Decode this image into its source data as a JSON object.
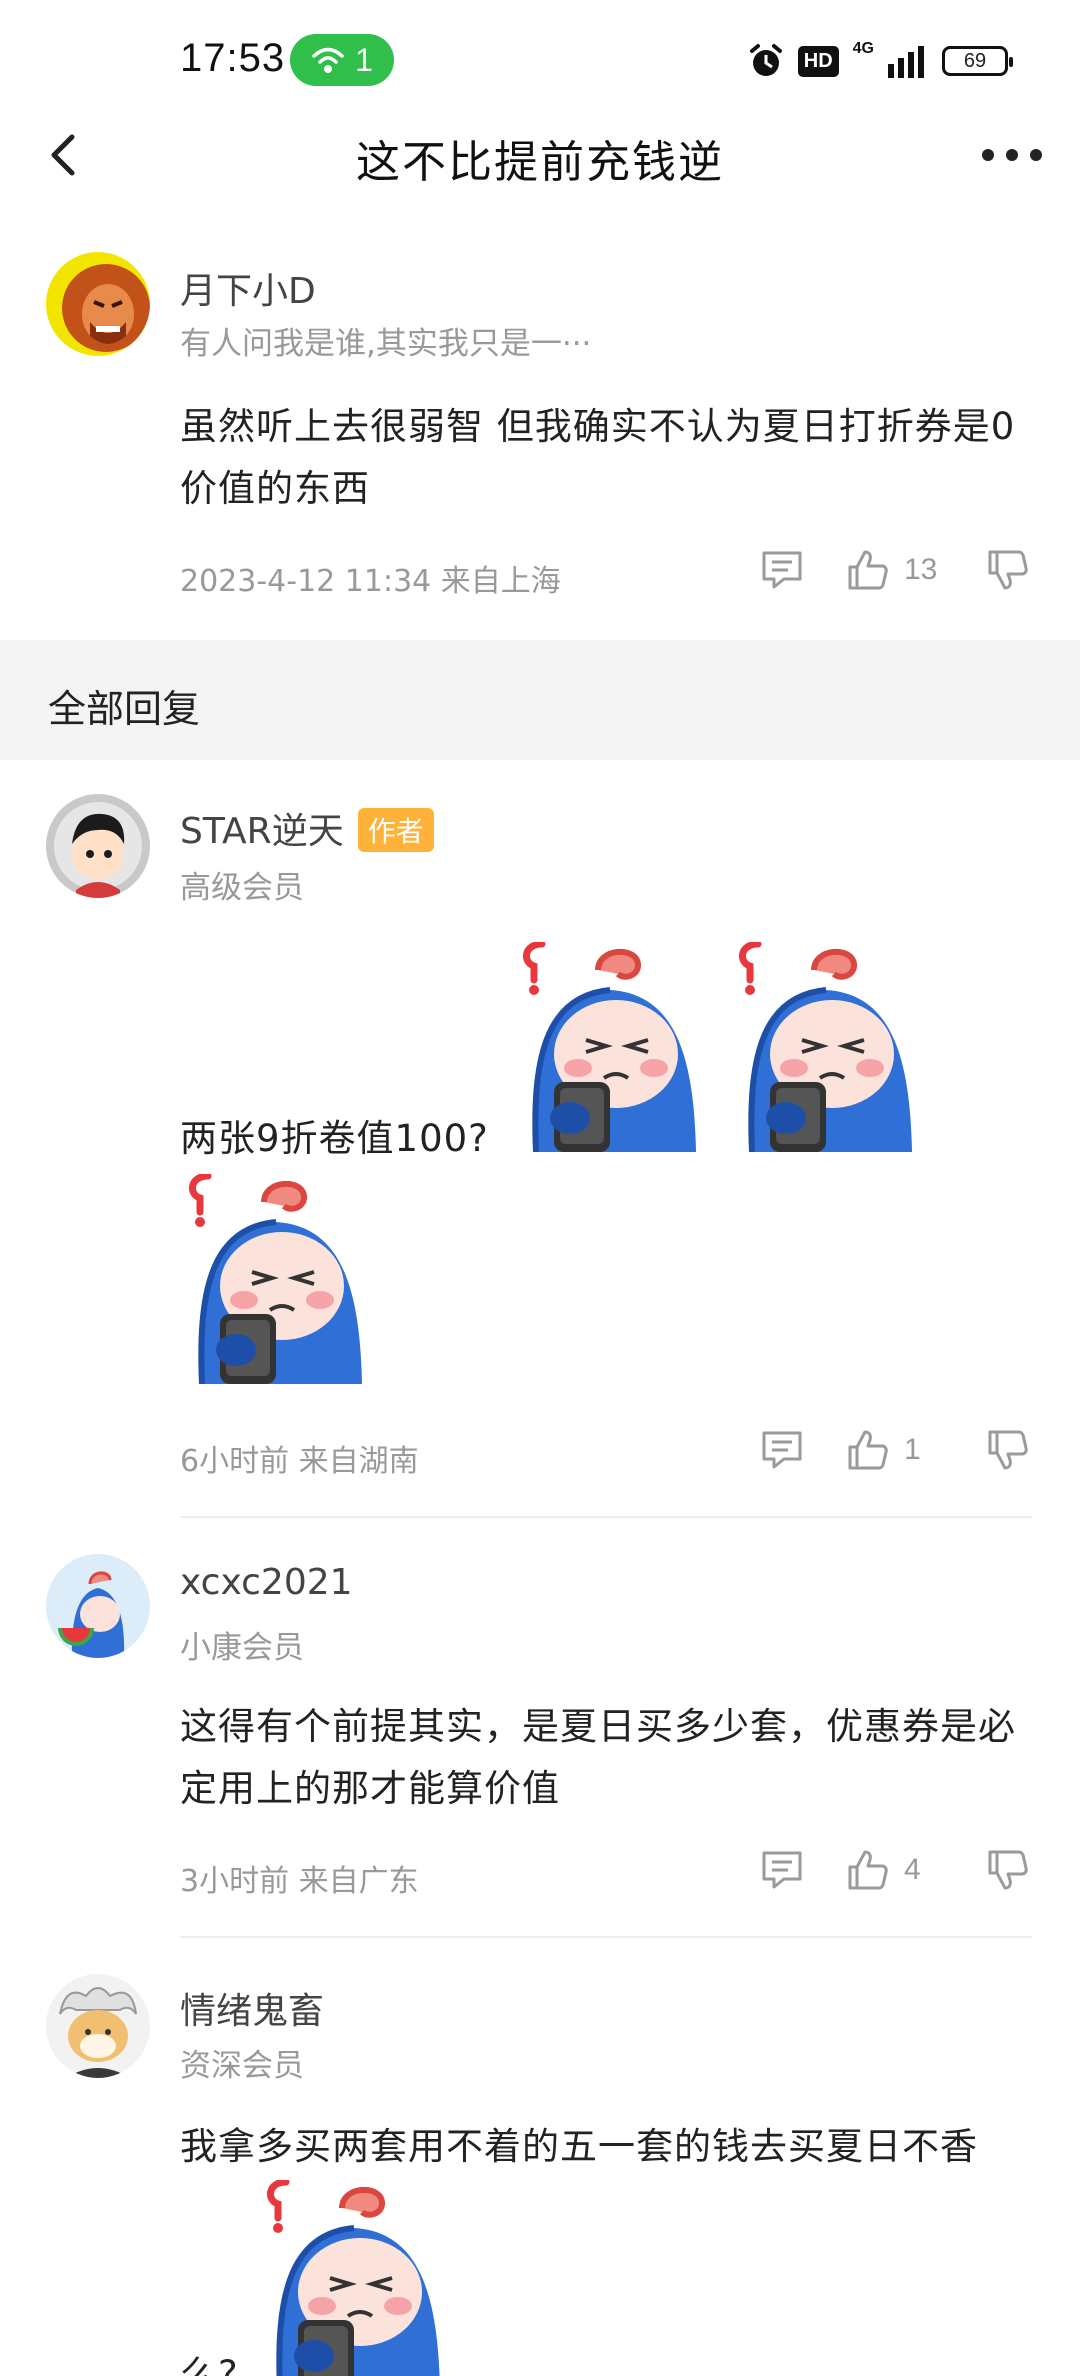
{
  "status": {
    "time": "17:53",
    "hotspot_count": "1",
    "network": "4G",
    "battery": "69"
  },
  "nav": {
    "title": "这不比提前充钱逆"
  },
  "main_post": {
    "username": "月下小D",
    "signature": "有人问我是谁,其实我只是一···",
    "text": "虽然听上去很弱智 但我确实不认为夏日打折券是0价值的东西",
    "meta": "2023-4-12 11:34 来自上海",
    "likes": "13"
  },
  "section": {
    "title": "全部回复"
  },
  "replies": [
    {
      "username": "STAR逆天",
      "badge": "作者",
      "level": "高级会员",
      "text": "两张9折卷值100?",
      "meta": "6小时前 来自湖南",
      "likes": "1"
    },
    {
      "username": "xcxc2021",
      "level": "小康会员",
      "text": "这得有个前提其实，是夏日买多少套，优惠券是必定用上的那才能算价值",
      "meta": "3小时前 来自广东",
      "likes": "4"
    },
    {
      "username": "情绪鬼畜",
      "level": "资深会员",
      "text": "我拿多买两套用不着的五一套的钱去买夏日不香",
      "text_tail": "么?"
    }
  ],
  "colors": {
    "hotspot": "#2fbf4a",
    "author_badge": "#ffb23a",
    "section_bg": "#f4f4f4",
    "sticker_blue": "#2f6fd6"
  },
  "icons": [
    "back-icon",
    "more-icon",
    "comment-icon",
    "thumb-up-icon",
    "thumb-down-icon",
    "alarm-icon",
    "signal-icon",
    "battery-icon",
    "hotspot-icon"
  ]
}
